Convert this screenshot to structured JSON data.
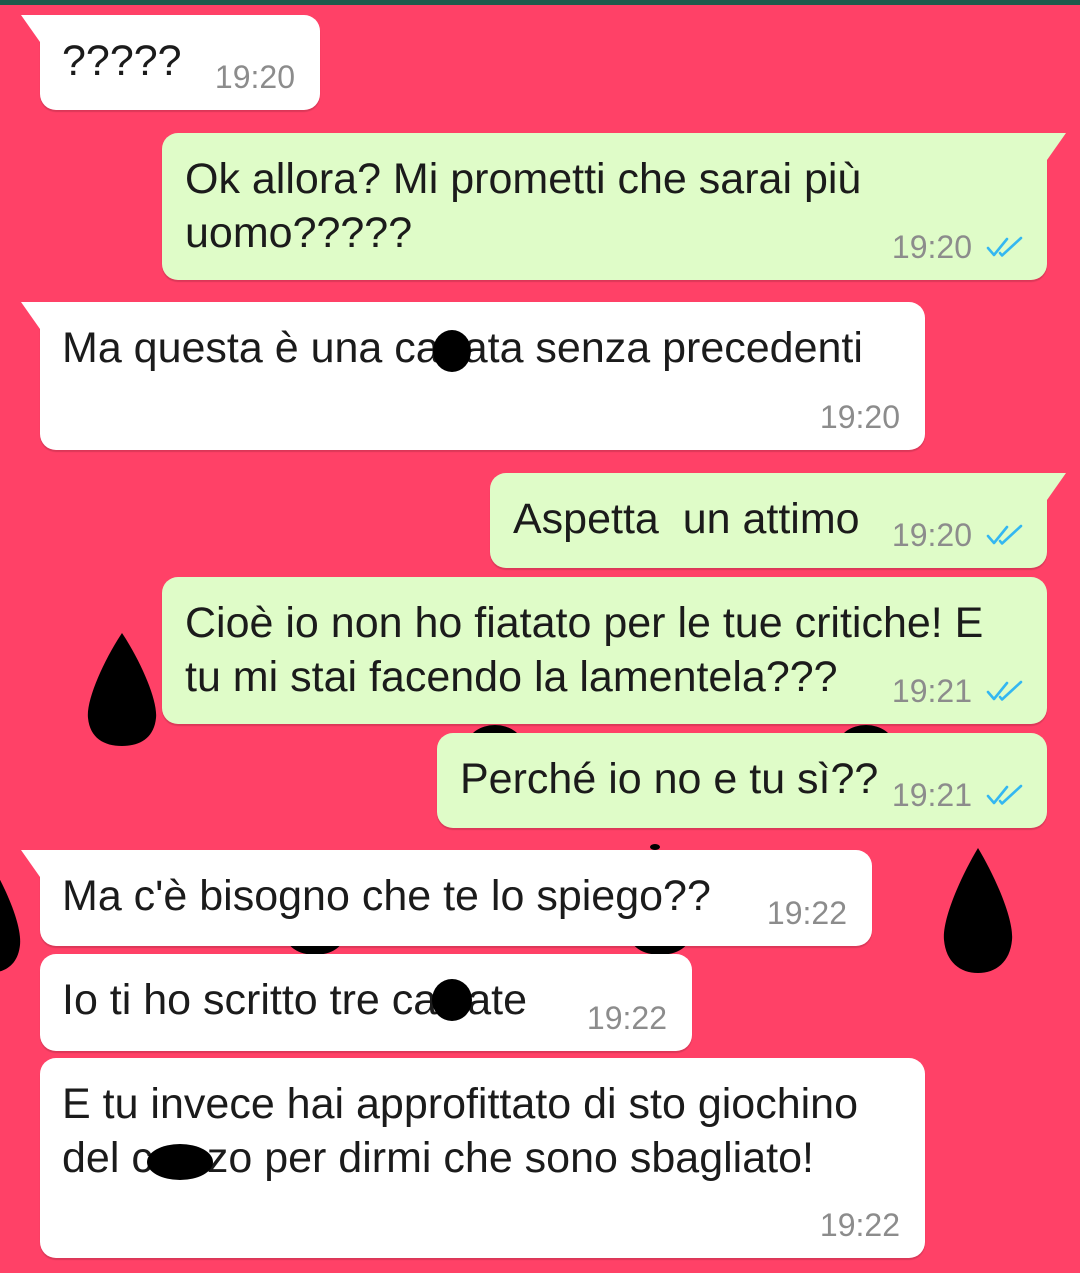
{
  "colors": {
    "top_bar": "#1F5A4C",
    "wallpaper": "#FF4167",
    "seed": "#000000",
    "incoming_bubble": "#FFFFFF",
    "outgoing_bubble": "#DFFCC8",
    "message_text": "#1B1B1B",
    "timestamp": "#8C8C8C",
    "read_ticks": "#34B7F1",
    "censor": "#000000"
  },
  "messages": [
    {
      "direction": "incoming",
      "lines": [
        "?????"
      ],
      "time": "19:20"
    },
    {
      "direction": "outgoing",
      "lines": [
        "Ok allora? Mi prometti che sarai più",
        "uomo?????"
      ],
      "time": "19:20",
      "status_icon": "double-check-icon"
    },
    {
      "direction": "incoming",
      "lines": [
        [
          "Ma questa è una ca",
          "ata senza precedenti"
        ]
      ],
      "time": "19:20"
    },
    {
      "direction": "outgoing",
      "lines": [
        "Aspetta  un attimo"
      ],
      "time": "19:20",
      "status_icon": "double-check-icon"
    },
    {
      "direction": "outgoing",
      "lines": [
        "Cioè io non ho fiatato per le tue critiche! E",
        "tu mi stai facendo la lamentela???"
      ],
      "time": "19:21",
      "status_icon": "double-check-icon"
    },
    {
      "direction": "outgoing",
      "lines": [
        "Perché io no e tu sì??"
      ],
      "time": "19:21",
      "status_icon": "double-check-icon"
    },
    {
      "direction": "incoming",
      "lines": [
        "Ma c'è bisogno che te lo spiego??"
      ],
      "time": "19:22"
    },
    {
      "direction": "incoming",
      "lines": [
        [
          "Io ti ho scritto tre ca",
          "ate"
        ]
      ],
      "time": "19:22"
    },
    {
      "direction": "incoming",
      "lines": [
        "E tu invece hai approfittato di sto giochino",
        [
          "del c",
          "zo per dirmi che sono sbagliato!"
        ]
      ],
      "time": "19:22"
    }
  ]
}
